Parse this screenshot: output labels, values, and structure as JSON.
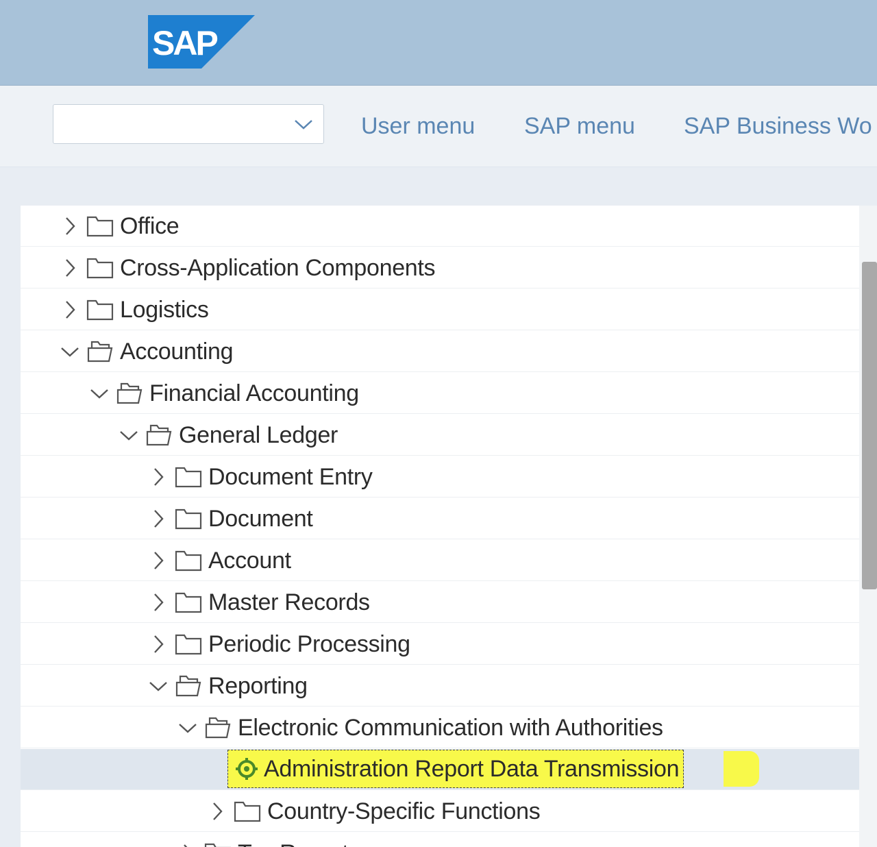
{
  "header": {
    "logo_text": "SAP",
    "logo_color": "#1e7fd0"
  },
  "toolbar": {
    "menu_select_value": "",
    "links": [
      "User menu",
      "SAP menu",
      "SAP Business Wo"
    ]
  },
  "tree": {
    "items": [
      {
        "label": "Office",
        "level": 0,
        "expanded": false,
        "icon": "folder-icon"
      },
      {
        "label": "Cross-Application Components",
        "level": 0,
        "expanded": false,
        "icon": "folder-icon"
      },
      {
        "label": "Logistics",
        "level": 0,
        "expanded": false,
        "icon": "folder-icon"
      },
      {
        "label": "Accounting",
        "level": 0,
        "expanded": true,
        "icon": "folder-open-icon"
      },
      {
        "label": "Financial Accounting",
        "level": 1,
        "expanded": true,
        "icon": "folder-open-icon"
      },
      {
        "label": "General Ledger",
        "level": 2,
        "expanded": true,
        "icon": "folder-open-icon"
      },
      {
        "label": "Document Entry",
        "level": 3,
        "expanded": false,
        "icon": "folder-icon"
      },
      {
        "label": "Document",
        "level": 3,
        "expanded": false,
        "icon": "folder-icon"
      },
      {
        "label": "Account",
        "level": 3,
        "expanded": false,
        "icon": "folder-icon"
      },
      {
        "label": "Master Records",
        "level": 3,
        "expanded": false,
        "icon": "folder-icon"
      },
      {
        "label": "Periodic Processing",
        "level": 3,
        "expanded": false,
        "icon": "folder-icon"
      },
      {
        "label": "Reporting",
        "level": 3,
        "expanded": true,
        "icon": "folder-open-icon"
      },
      {
        "label": "Electronic Communication with Authorities",
        "level": 4,
        "expanded": true,
        "icon": "folder-open-icon"
      },
      {
        "label": "Administration Report Data Transmission",
        "level": 5,
        "expanded": null,
        "icon": "transaction-icon",
        "selected": true,
        "highlight_color": "#f8f94a"
      },
      {
        "label": "Country-Specific Functions",
        "level": 5,
        "expanded": false,
        "icon": "folder-icon"
      },
      {
        "label": "Tax Reports",
        "level": 4,
        "expanded": false,
        "icon": "folder-icon"
      }
    ]
  }
}
